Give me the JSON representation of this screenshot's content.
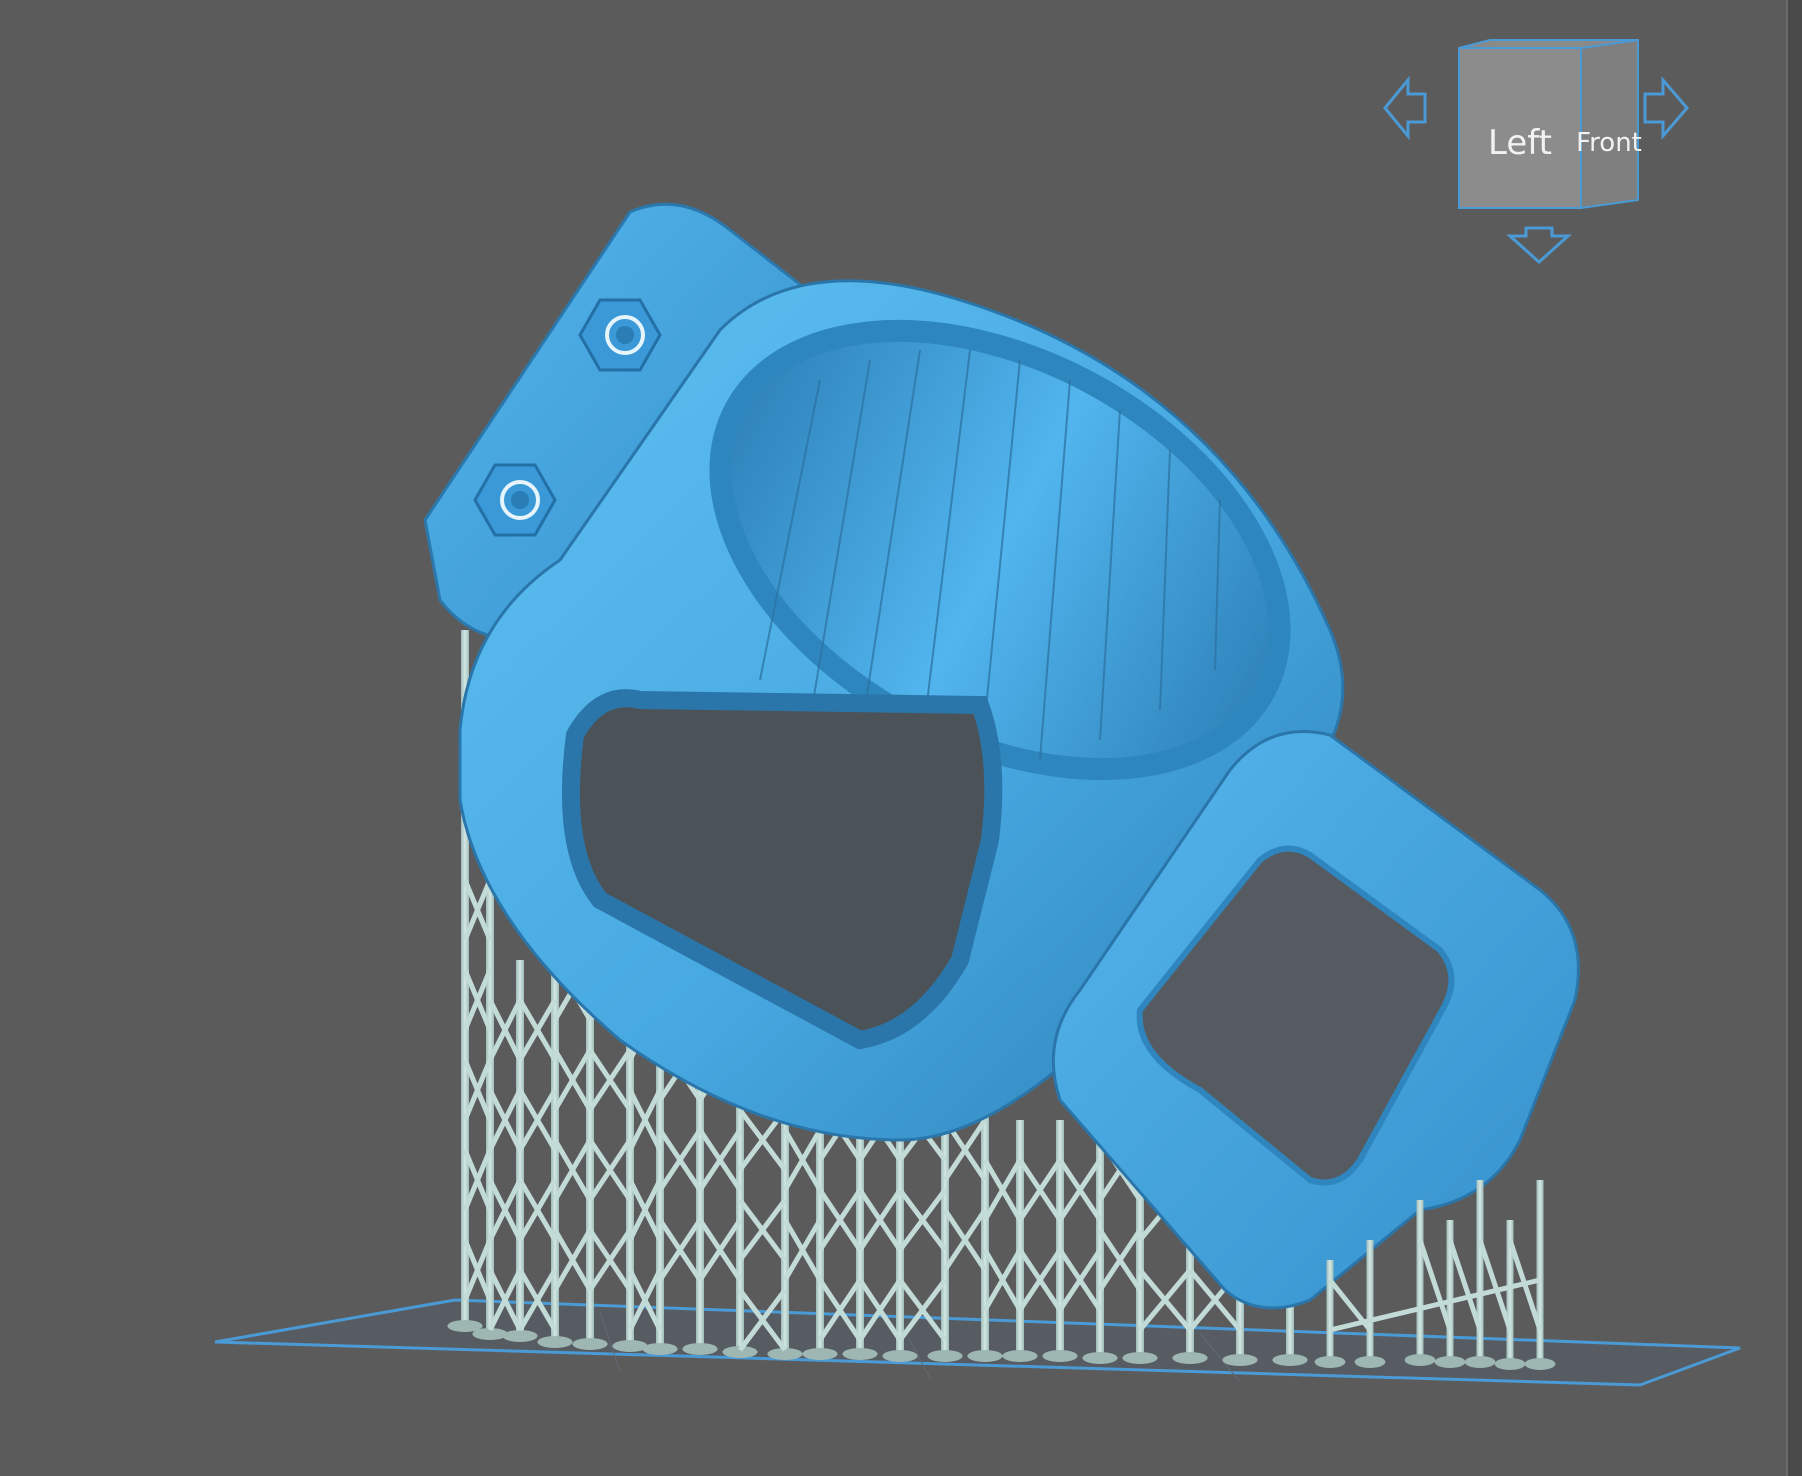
{
  "viewport": {
    "background": "#5b5b5b",
    "model_color": "#4fb3ea",
    "support_color": "#b9d3d0",
    "build_plate_color": "#4a9ad6"
  },
  "nav_cube": {
    "face_left": "Left",
    "face_front": "Front",
    "arrow_left_icon": "arrow-left-icon",
    "arrow_right_icon": "arrow-right-icon",
    "arrow_down_icon": "arrow-down-icon"
  }
}
